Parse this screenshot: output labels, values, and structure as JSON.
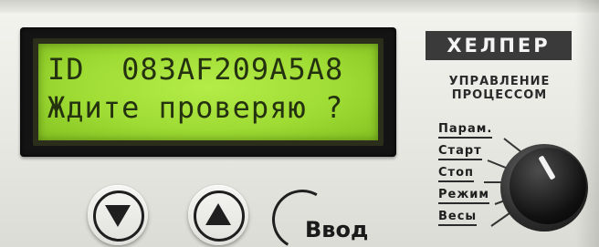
{
  "lcd": {
    "line1": "ID  083AF209A5A8",
    "line2": "Ждите проверяю ?",
    "backlight_color": "#a8e43c",
    "text_color": "#25320f"
  },
  "brand": {
    "name": "ХЕЛПЕР",
    "subtitle_line1": "УПРАВЛЕНИЕ",
    "subtitle_line2": "ПРОЦЕССОМ"
  },
  "modes": [
    "Парам.",
    "Старт",
    "Стоп",
    "Режим",
    "Весы"
  ],
  "buttons": {
    "enter_label": "Ввод",
    "down_icon": "triangle-down-icon",
    "up_icon": "triangle-up-icon"
  },
  "knob": {
    "icon": "rotary-knob-icon"
  }
}
